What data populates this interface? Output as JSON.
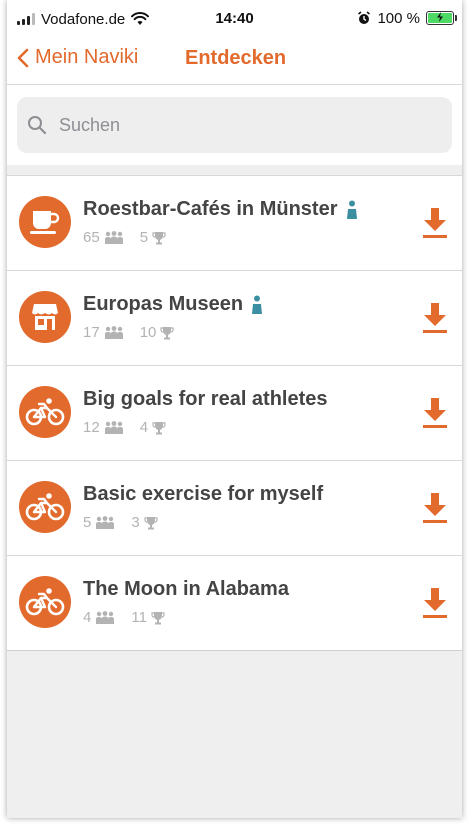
{
  "statusbar": {
    "carrier": "Vodafone.de",
    "time": "14:40",
    "battery_label": "100 %"
  },
  "nav": {
    "back_label": "Mein Naviki",
    "title": "Entdecken"
  },
  "search": {
    "placeholder": "Suchen"
  },
  "colors": {
    "accent": "#e26a2c",
    "personal_marker": "#3c8fa0"
  },
  "items": [
    {
      "title": "Roestbar-Cafés in Münster",
      "members": "65",
      "goals": "5",
      "icon": "coffee-cup-icon",
      "owned": true
    },
    {
      "title": "Europas Museen",
      "members": "17",
      "goals": "10",
      "icon": "museum-icon",
      "owned": true
    },
    {
      "title": "Big goals for real athletes",
      "members": "12",
      "goals": "4",
      "icon": "bicycle-icon",
      "owned": false
    },
    {
      "title": "Basic exercise for myself",
      "members": "5",
      "goals": "3",
      "icon": "bicycle-icon",
      "owned": false
    },
    {
      "title": "The Moon in Alabama",
      "members": "4",
      "goals": "11",
      "icon": "bicycle-icon",
      "owned": false
    }
  ]
}
